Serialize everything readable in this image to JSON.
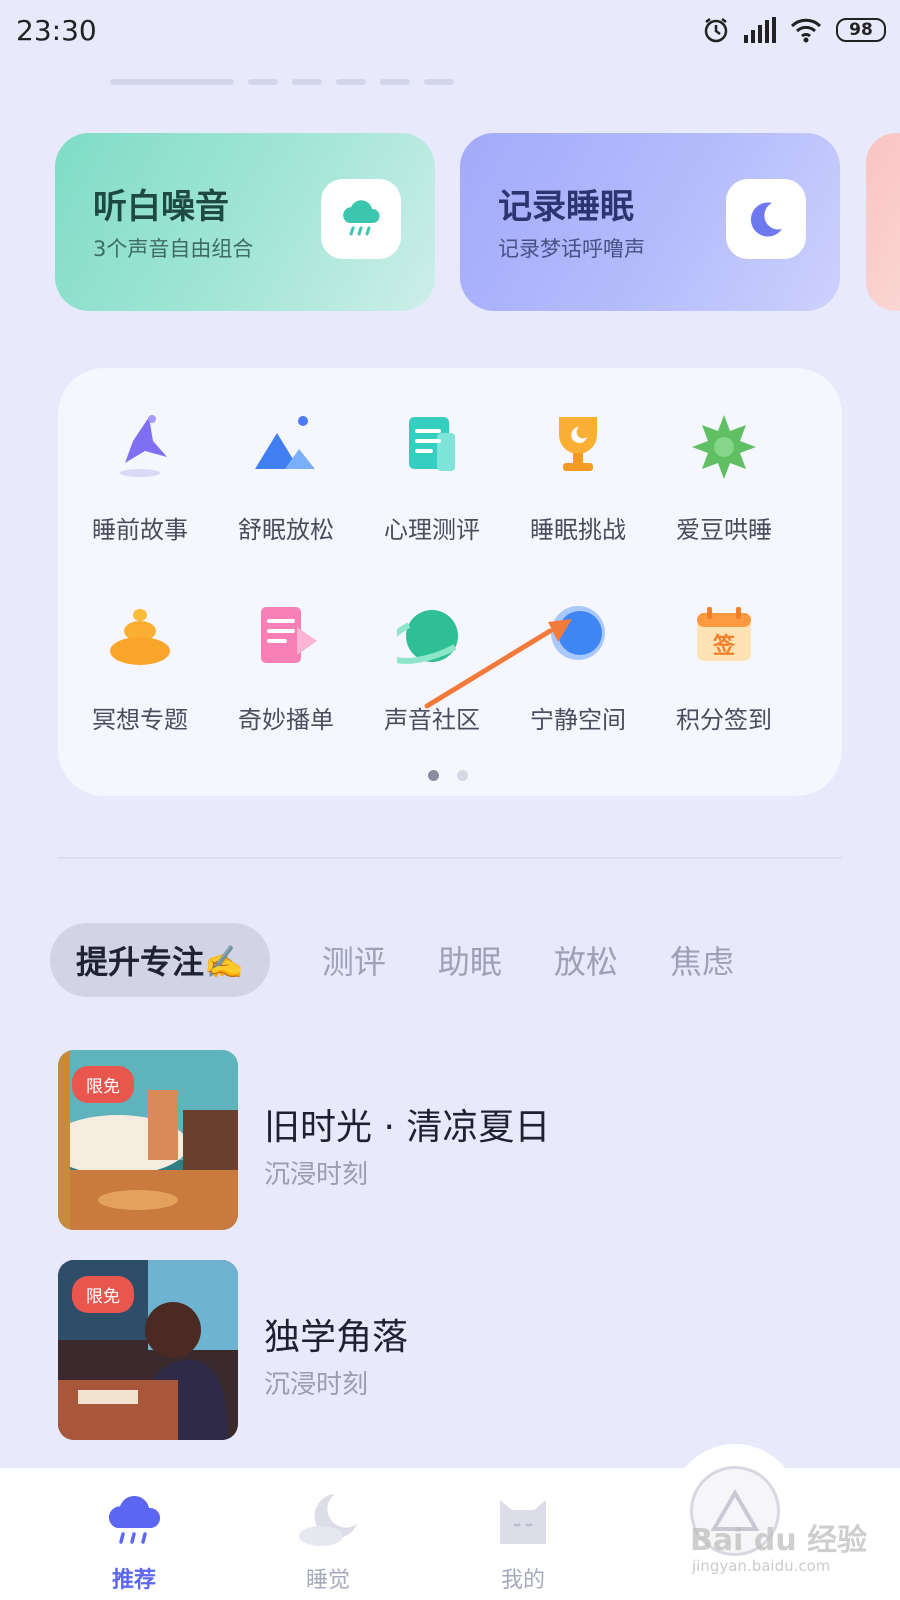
{
  "status_bar": {
    "time": "23:30",
    "battery": "98"
  },
  "feature_cards": [
    {
      "title": "听白噪音",
      "subtitle": "3个声音自由组合",
      "icon": "rain-cloud-icon"
    },
    {
      "title": "记录睡眠",
      "subtitle": "记录梦话呼噜声",
      "icon": "moon-icon"
    }
  ],
  "quick_entries": [
    {
      "label": "睡前故事",
      "icon": "spinning-top-icon"
    },
    {
      "label": "舒眠放松",
      "icon": "mountain-icon"
    },
    {
      "label": "心理测评",
      "icon": "document-icon"
    },
    {
      "label": "睡眠挑战",
      "icon": "trophy-icon"
    },
    {
      "label": "爱豆哄睡",
      "icon": "star-burst-icon"
    },
    {
      "label": "冥想专题",
      "icon": "meditation-stones-icon"
    },
    {
      "label": "奇妙播单",
      "icon": "playlist-icon"
    },
    {
      "label": "声音社区",
      "icon": "planet-icon"
    },
    {
      "label": "宁静空间",
      "icon": "sphere-icon"
    },
    {
      "label": "积分签到",
      "icon": "calendar-checkin-icon",
      "glyph": "签"
    }
  ],
  "tabs": [
    "提升专注✍️",
    "测评",
    "助眠",
    "放松",
    "焦虑"
  ],
  "list": [
    {
      "badge": "限免",
      "title": "旧时光 · 清凉夏日",
      "subtitle": "沉浸时刻"
    },
    {
      "badge": "限免",
      "title": "独学角落",
      "subtitle": "沉浸时刻"
    }
  ],
  "bottom_nav": [
    {
      "label": "推荐",
      "icon": "rain-cloud-icon",
      "active": true
    },
    {
      "label": "睡觉",
      "icon": "moon-cloud-icon",
      "active": false
    },
    {
      "label": "我的",
      "icon": "cat-icon",
      "active": false
    }
  ],
  "watermark": {
    "main": "Bai du 经验",
    "sub": "jingyan.baidu.com"
  },
  "colors": {
    "accent": "#5b67f2",
    "badge": "#e8564e",
    "arrow": "#f47a3a"
  }
}
